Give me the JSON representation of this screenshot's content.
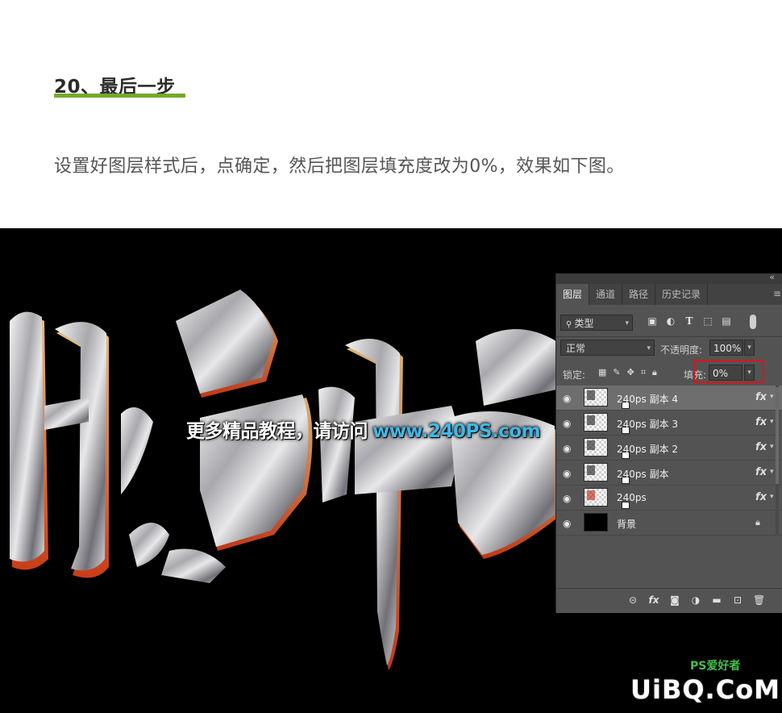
{
  "article": {
    "step_title": "20、最后一步",
    "description": "设置好图层样式后，点确定，然后把图层填充度改为0%，效果如下图。"
  },
  "canvas": {
    "watermark_cn": "更多精品教程，请访问",
    "watermark_url": "www.240PS.com",
    "logo_text": "UiBQ.CoM",
    "logo_sub": "PS爱好者"
  },
  "layers_panel": {
    "tabs": [
      {
        "label": "图层",
        "active": true
      },
      {
        "label": "通道",
        "active": false
      },
      {
        "label": "路径",
        "active": false
      },
      {
        "label": "历史记录",
        "active": false
      }
    ],
    "filter_select": "类型",
    "blend_mode": "正常",
    "opacity_label": "不透明度:",
    "opacity_value": "100%",
    "lock_label": "锁定:",
    "fill_label": "填充:",
    "fill_value": "0%",
    "layers": [
      {
        "name": "240ps 副本 4",
        "has_fx": true,
        "selected": true
      },
      {
        "name": "240ps 副本 3",
        "has_fx": true,
        "selected": false
      },
      {
        "name": "240ps 副本 2",
        "has_fx": true,
        "selected": false
      },
      {
        "name": "240ps  副本",
        "has_fx": true,
        "selected": false
      },
      {
        "name": "240ps",
        "has_fx": true,
        "selected": false
      },
      {
        "name": "背景",
        "has_fx": false,
        "locked": true,
        "selected": false
      }
    ]
  },
  "colors": {
    "accent_underline": "#74a82a",
    "highlight_box": "#e0121b",
    "url_color": "#3fb8e8",
    "panel_bg": "#535353"
  }
}
